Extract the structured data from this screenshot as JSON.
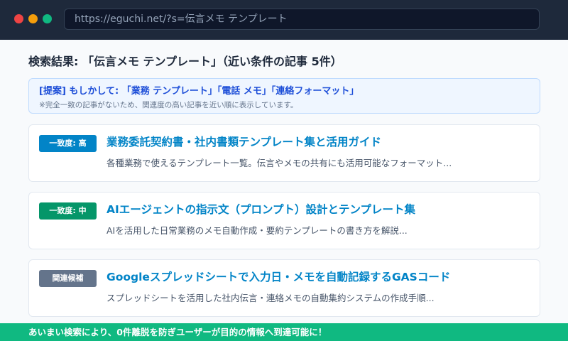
{
  "browser": {
    "url": "https://eguchi.net/?s=伝言メモ テンプレート"
  },
  "search": {
    "heading": "検索結果: 「伝言メモ テンプレート」（近い条件の記事 5件）",
    "suggestion": {
      "text": "[提案] もしかして: 「業務 テンプレート」「電話 メモ」「連絡フォーマット」",
      "note": "※完全一致の記事がないため、関連度の高い記事を近い順に表示しています。"
    },
    "results": [
      {
        "badge": "一致度: 高",
        "badge_color": "#0284c7",
        "title": "業務委託契約書・社内書類テンプレート集と活用ガイド",
        "description": "各種業務で使えるテンプレート一覧。伝言やメモの共有にも活用可能なフォーマット..."
      },
      {
        "badge": "一致度: 中",
        "badge_color": "#059669",
        "title": "AIエージェントの指示文（プロンプト）設計とテンプレート集",
        "description": "AIを活用した日常業務のメモ自動作成・要約テンプレートの書き方を解説..."
      },
      {
        "badge": "関連候補",
        "badge_color": "#64748b",
        "title": "Googleスプレッドシートで入力日・メモを自動記録するGASコード",
        "description": "スプレッドシートを活用した社内伝言・連絡メモの自動集約システムの作成手順..."
      }
    ]
  },
  "footer": {
    "text": "あいまい検索により、0件離脱を防ぎユーザーが目的の情報へ到達可能に！"
  }
}
